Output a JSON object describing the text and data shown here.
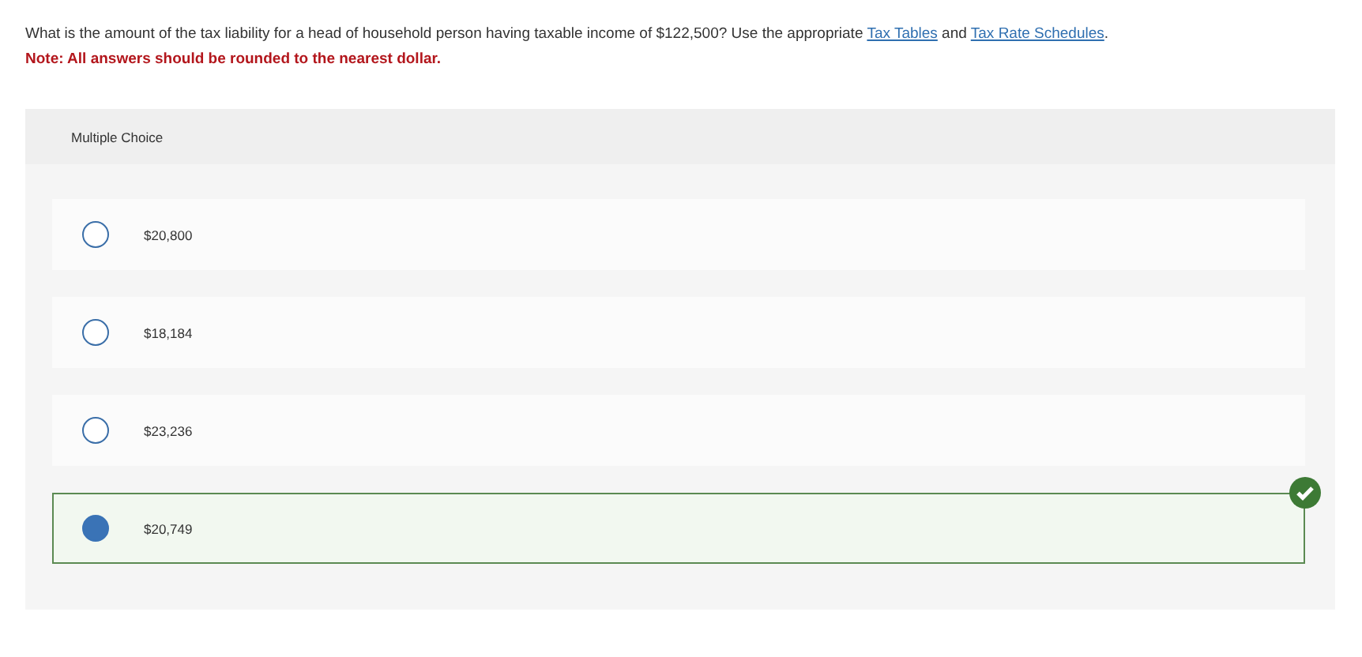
{
  "question": {
    "before": "What is the amount of the tax liability for a head of household person having taxable income of $122,500? Use the appropriate",
    "link_1": "Tax Tables",
    "between": "and",
    "link_2": "Tax Rate Schedules",
    "after": "."
  },
  "note": "Note: All answers should be rounded to the nearest dollar.",
  "panel": {
    "title": "Multiple Choice"
  },
  "choices": [
    {
      "label": "$20,800",
      "selected": false,
      "correct": false
    },
    {
      "label": "$18,184",
      "selected": false,
      "correct": false
    },
    {
      "label": "$23,236",
      "selected": false,
      "correct": false
    },
    {
      "label": "$20,749",
      "selected": true,
      "correct": true
    }
  ]
}
